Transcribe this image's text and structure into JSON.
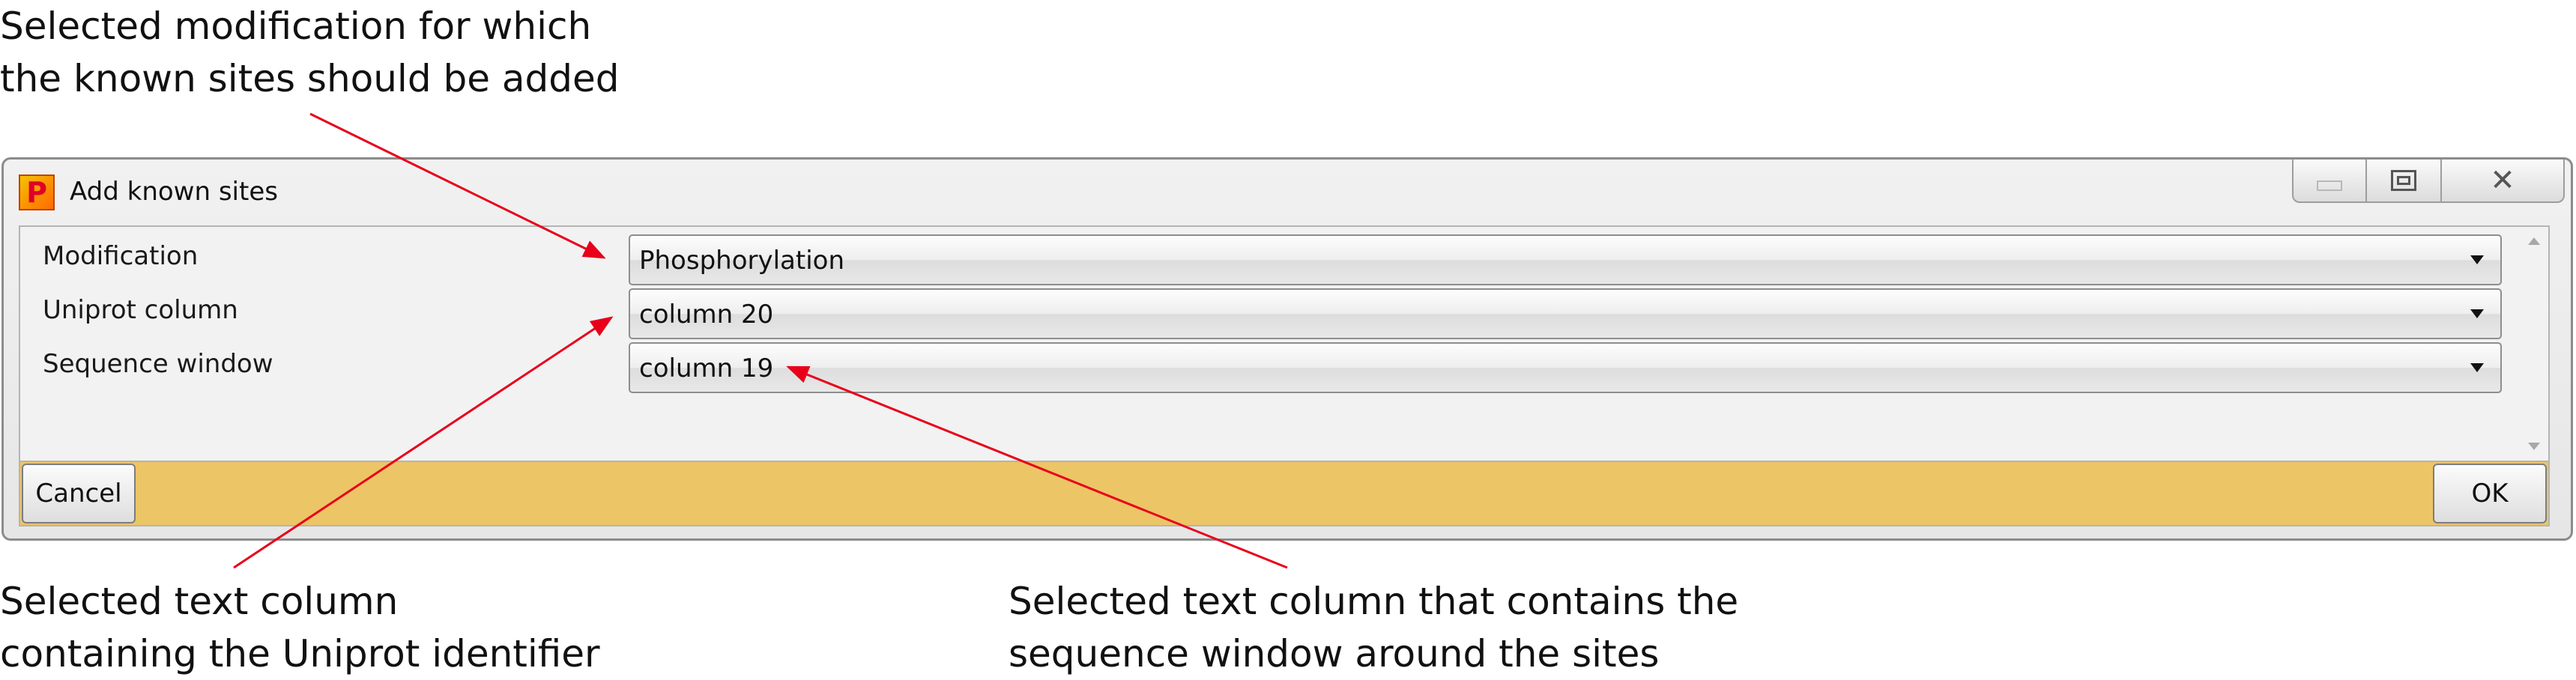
{
  "annotations": {
    "top": "Selected modification for which\nthe known sites should be added",
    "bottom_left": "Selected text column\ncontaining the Uniprot identifier",
    "bottom_right": "Selected text column that contains the\nsequence window around the sites"
  },
  "window": {
    "title": "Add known sites",
    "app_icon_letter": "P",
    "controls": {
      "minimize": "minimize-icon",
      "maximize": "maximize-icon",
      "close_glyph": "✕"
    }
  },
  "form": {
    "fields": [
      {
        "label": "Modification",
        "value": "Phosphorylation"
      },
      {
        "label": "Uniprot column",
        "value": "column 20"
      },
      {
        "label": "Sequence window",
        "value": "column 19"
      }
    ]
  },
  "buttons": {
    "cancel": "Cancel",
    "ok": "OK"
  },
  "colors": {
    "button_bar": "#ecc566",
    "arrow": "#e8001a"
  }
}
